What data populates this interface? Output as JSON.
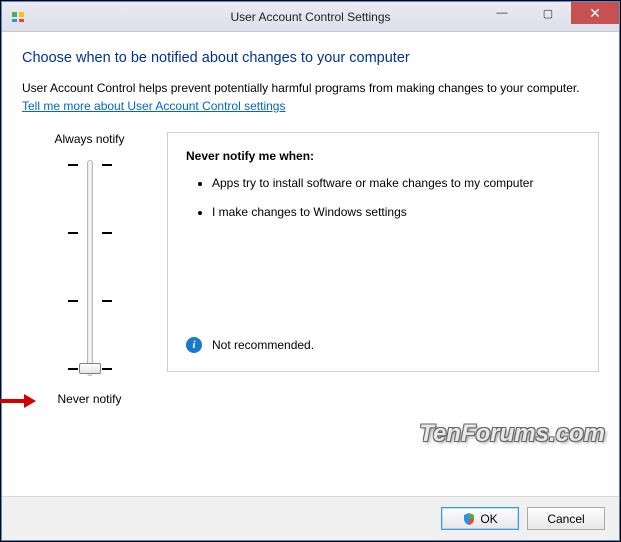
{
  "window": {
    "title": "User Account Control Settings",
    "close_glyph": "✕",
    "min_glyph": "—",
    "max_glyph": "▢"
  },
  "heading": "Choose when to be notified about changes to your computer",
  "subtext": "User Account Control helps prevent potentially harmful programs from making changes to your computer.",
  "link": "Tell me more about User Account Control settings",
  "slider": {
    "top_label": "Always notify",
    "bottom_label": "Never notify"
  },
  "desc": {
    "title": "Never notify me when:",
    "items": [
      "Apps try to install software or make changes to my computer",
      "I make changes to Windows settings"
    ],
    "recommendation": "Not recommended."
  },
  "buttons": {
    "ok": "OK",
    "cancel": "Cancel"
  },
  "watermark": "TenForums.com"
}
